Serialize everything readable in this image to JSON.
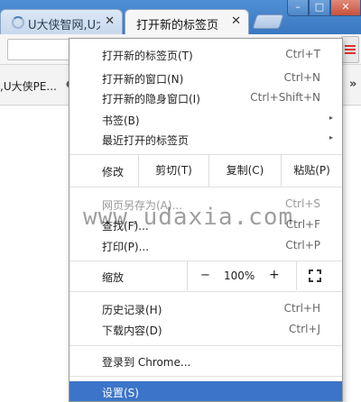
{
  "tabs": [
    {
      "title": "U大侠智网,U大",
      "close": "✕"
    },
    {
      "title": "打开新的标签页",
      "close": "✕"
    }
  ],
  "window_controls": {
    "minimize": "–",
    "maximize": "□",
    "close": "✕"
  },
  "bookmarks": {
    "item": ",U大侠PE...",
    "more": "»"
  },
  "menu": {
    "group1": [
      {
        "label": "打开新的标签页(T)",
        "shortcut": "Ctrl+T"
      },
      {
        "label": "打开新的窗口(N)",
        "shortcut": "Ctrl+N"
      },
      {
        "label": "打开新的隐身窗口(I)",
        "shortcut": "Ctrl+Shift+N"
      },
      {
        "label": "书签(B)",
        "arrow": "▸"
      },
      {
        "label": "最近打开的标签页",
        "arrow": "▸"
      }
    ],
    "edit": {
      "label": "修改",
      "cut": "剪切(T)",
      "copy": "复制(C)",
      "paste": "粘贴(P)"
    },
    "group2": [
      {
        "label": "网页另存为(A)...",
        "shortcut": "Ctrl+S"
      },
      {
        "label": "查找(F)...",
        "shortcut": "Ctrl+F"
      },
      {
        "label": "打印(P)...",
        "shortcut": "Ctrl+P"
      }
    ],
    "zoom": {
      "label": "缩放",
      "minus": "−",
      "value": "100%",
      "plus": "+"
    },
    "group3": [
      {
        "label": "历史记录(H)",
        "shortcut": "Ctrl+H"
      },
      {
        "label": "下载内容(D)",
        "shortcut": "Ctrl+J"
      }
    ],
    "signin": {
      "label": "登录到 Chrome..."
    },
    "settings": {
      "label": "设置(S)"
    }
  },
  "watermark": "www.udaxia.com",
  "colors": {
    "highlight": "#3b74c8",
    "menu_icon": "#dd3333"
  }
}
